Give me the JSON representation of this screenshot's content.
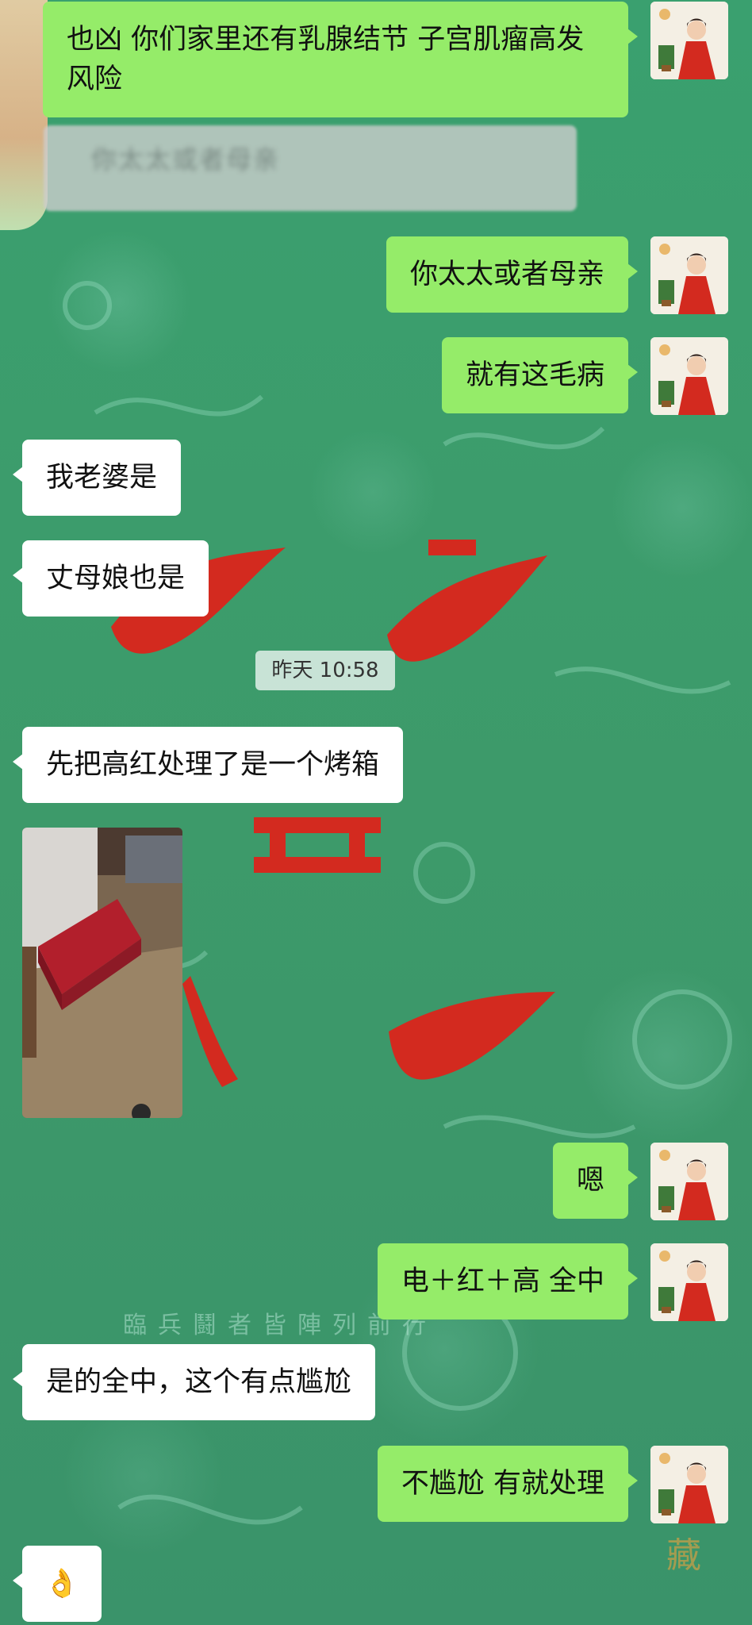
{
  "messages": [
    {
      "id": "m1",
      "side": "right",
      "text": "也凶  你们家里还有乳腺结节  子宫肌瘤高发风险"
    },
    {
      "id": "m2",
      "side": "left",
      "text": "你太太或者母亲",
      "blurred": true
    },
    {
      "id": "m3",
      "side": "right",
      "text": "你太太或者母亲"
    },
    {
      "id": "m4",
      "side": "right",
      "text": "就有这毛病"
    },
    {
      "id": "m5",
      "side": "left",
      "text": "我老婆是"
    },
    {
      "id": "m6",
      "side": "left",
      "text": "丈母娘也是"
    },
    {
      "id": "m7",
      "side": "left",
      "text": "先把高红处理了是一个烤箱"
    },
    {
      "id": "m8",
      "side": "left",
      "type": "image",
      "alt": "room-photo-red-box"
    },
    {
      "id": "m9",
      "side": "right",
      "text": "嗯"
    },
    {
      "id": "m10",
      "side": "right",
      "text": "电＋红＋高  全中"
    },
    {
      "id": "m11",
      "side": "left",
      "text": "是的全中，这个有点尴尬"
    },
    {
      "id": "m12",
      "side": "right",
      "text": "不尴尬  有就处理"
    },
    {
      "id": "m13",
      "side": "left",
      "text": "👌"
    }
  ],
  "timestamp": "昨天  10:58",
  "background": {
    "glyphs": [
      "飛",
      "圓",
      "臨兵鬪者皆陣列前行",
      "藏"
    ]
  },
  "colors": {
    "chat_bg": "#3f9a6e",
    "bubble_self": "#95ec69",
    "bubble_other": "#ffffff",
    "accent_red": "#d32a1f"
  }
}
